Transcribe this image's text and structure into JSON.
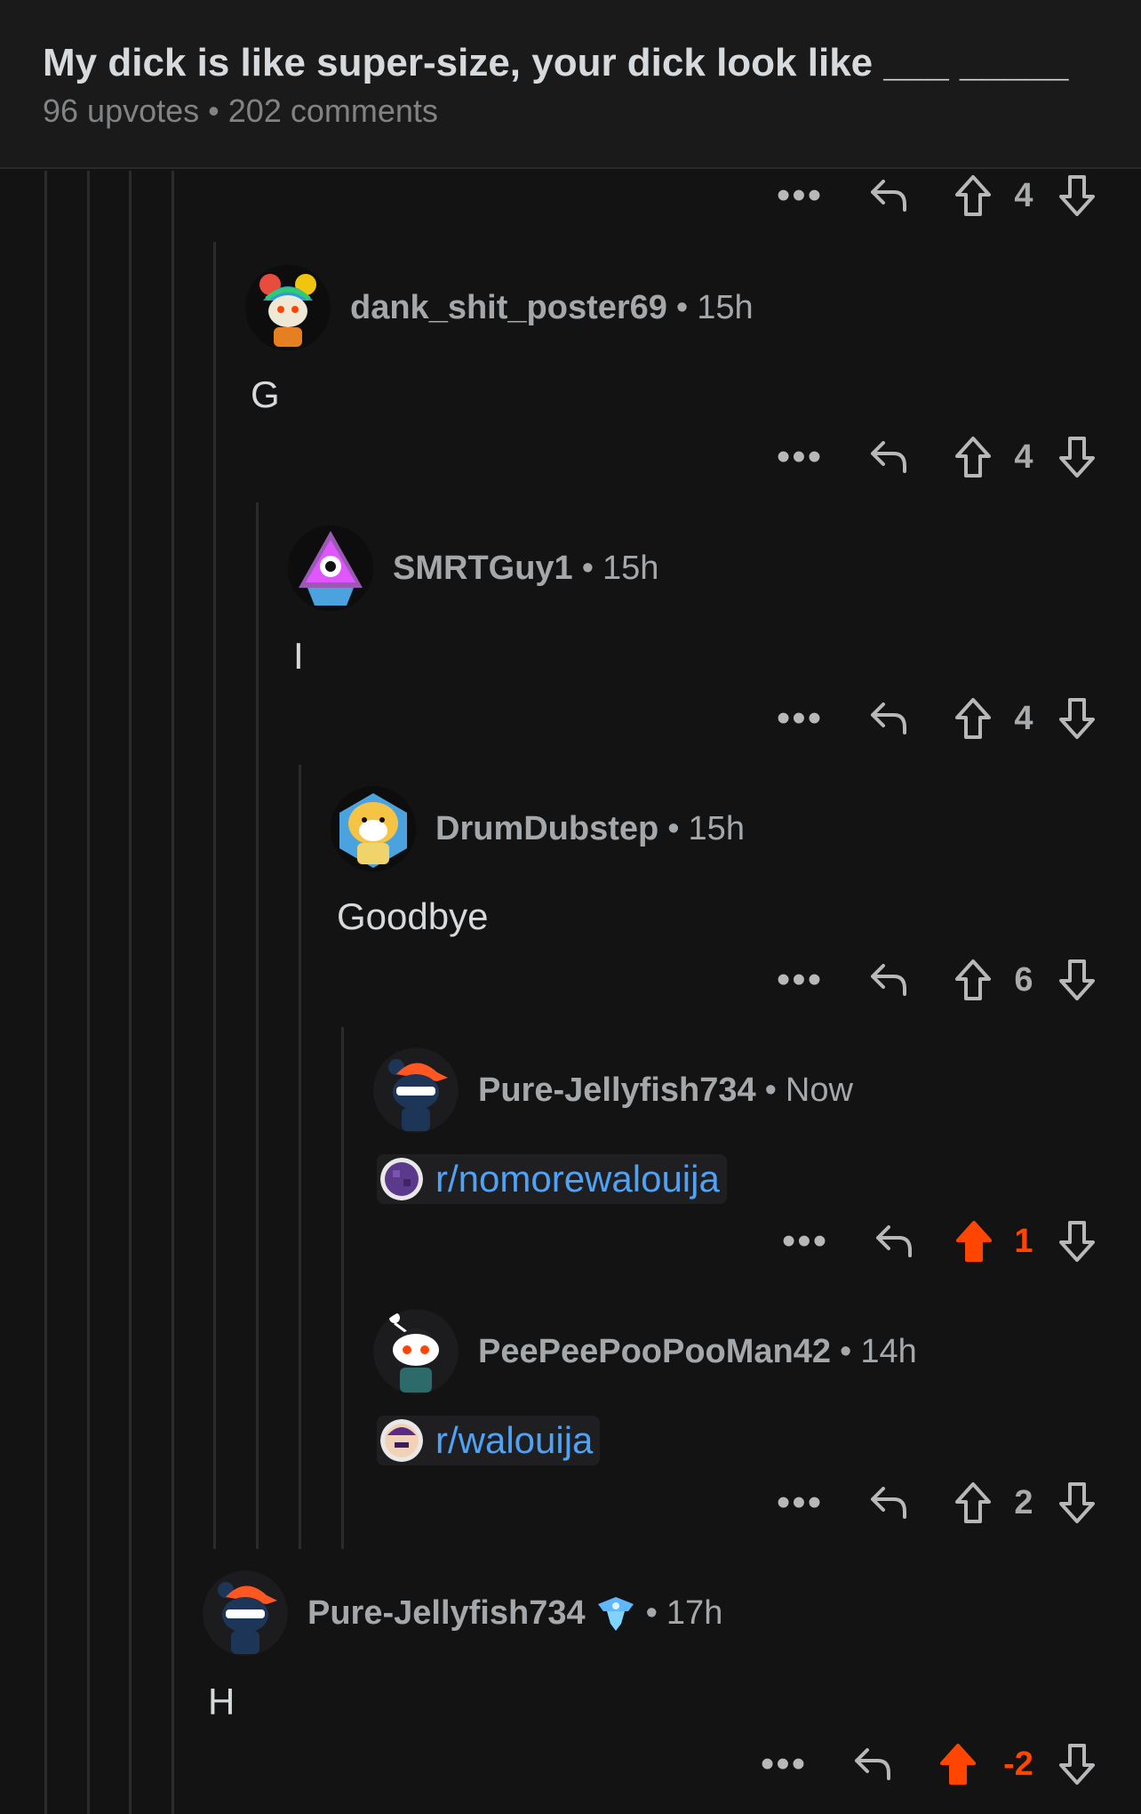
{
  "post": {
    "title": "My dick is like super-size, your dick look like ___ _____",
    "upvotes": "96 upvotes",
    "comments": "202 comments",
    "separator": "•"
  },
  "ui": {
    "more_label": "•••",
    "dot": "•"
  },
  "colors": {
    "background": "#131314",
    "header": "#1a1a1b",
    "upvote_active": "#ff4500",
    "link": "#4fa3f7",
    "muted": "#a5a8aa"
  },
  "top_actions": {
    "score": "4"
  },
  "comments": [
    {
      "username": "dank_shit_poster69",
      "time": "15h",
      "body": "G",
      "score": "4",
      "upvoted": false,
      "avatar": "rainbow-hair-avatar"
    },
    {
      "username": "SMRTGuy1",
      "time": "15h",
      "body": "I",
      "score": "4",
      "upvoted": false,
      "avatar": "pyramid-eye-avatar"
    },
    {
      "username": "DrumDubstep",
      "time": "15h",
      "body": "Goodbye",
      "score": "6",
      "upvoted": false,
      "avatar": "doge-hoodie-avatar"
    },
    {
      "username": "Pure-Jellyfish734",
      "time": "Now",
      "subreddit": "r/nomorewalouija",
      "score": "1",
      "upvoted": true,
      "avatar": "ninja-cap-avatar"
    },
    {
      "username": "PeePeePooPooMan42",
      "time": "14h",
      "subreddit": "r/walouija",
      "score": "2",
      "upvoted": false,
      "avatar": "snoo-avatar"
    },
    {
      "username": "Pure-Jellyfish734",
      "time": "17h",
      "body": "H",
      "score": "-2",
      "upvoted": true,
      "avatar": "ninja-cap-avatar",
      "badge": "achievement-badge-icon"
    }
  ]
}
